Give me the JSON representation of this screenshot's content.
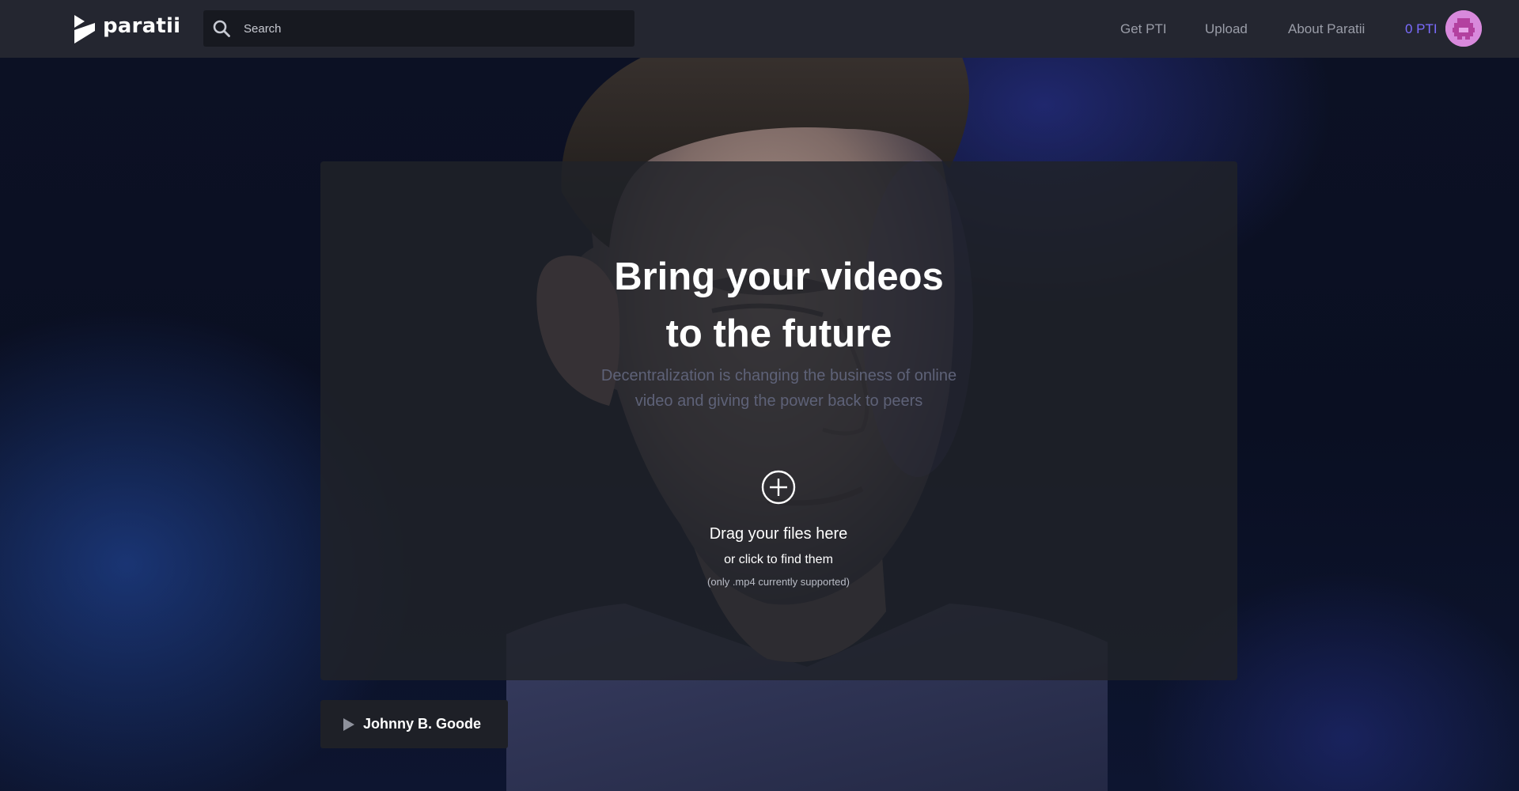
{
  "header": {
    "logo_text": "paratii",
    "search": {
      "placeholder": "Search",
      "value": ""
    },
    "nav": {
      "get_pti": "Get PTI",
      "upload": "Upload",
      "about": "About Paratii"
    },
    "balance": "0 PTI",
    "colors": {
      "bar": "#242630",
      "balance": "#7b6cff",
      "avatar": "#d889dc"
    }
  },
  "card": {
    "headline_line1": "Bring your videos",
    "headline_line2": "to the future",
    "subtitle_line1": "Decentralization is changing the business of online",
    "subtitle_line2": "video and giving the power back to peers",
    "upload_icon": "plus-circle-icon",
    "drag_title": "Drag your files here",
    "drag_subtitle": "or click to find them",
    "drag_note": "(only .mp4 currently supported)"
  },
  "now_playing": {
    "icon": "play-icon",
    "title": "Johnny B. Goode"
  }
}
